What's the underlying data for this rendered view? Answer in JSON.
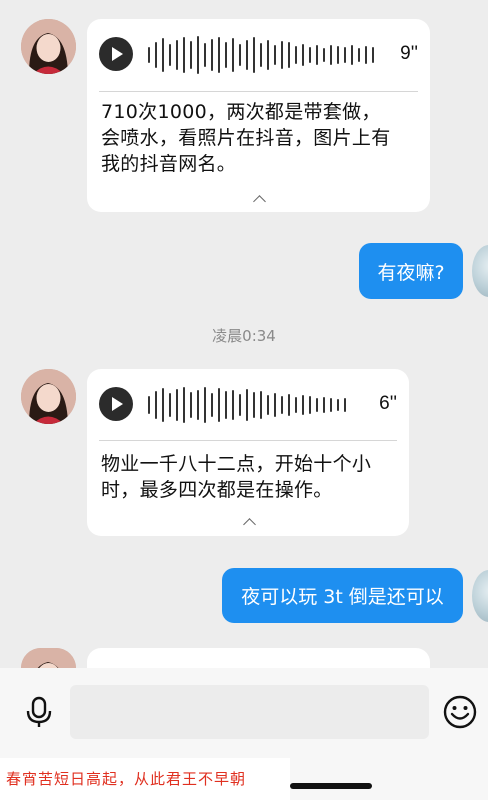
{
  "messages": [
    {
      "type": "voice_in",
      "duration": "9''",
      "transcript": "710次1000，两次都是带套做，\n会喷水，看照片在抖音，图片上有\n我的抖音网名。"
    },
    {
      "type": "text_out",
      "text": "有夜嘛?"
    },
    {
      "type": "timestamp",
      "text": "凌晨0:34"
    },
    {
      "type": "voice_in",
      "duration": "6''",
      "transcript": "物业一千八十二点，开始十个小\n时，最多四次都是在操作。"
    },
    {
      "type": "text_out",
      "text": "夜可以玩 3t 倒是还可以"
    }
  ],
  "input_bar": {
    "placeholder": "",
    "left_icon": "microphone-icon",
    "right_icon": "emoji-icon"
  },
  "watermark": {
    "text": "春宵苦短日高起，从此君王不早朝"
  },
  "colors": {
    "background": "#ededed",
    "bubble_out": "#1e8ff0",
    "bubble_in": "#ffffff",
    "watermark_text": "#e03020"
  }
}
